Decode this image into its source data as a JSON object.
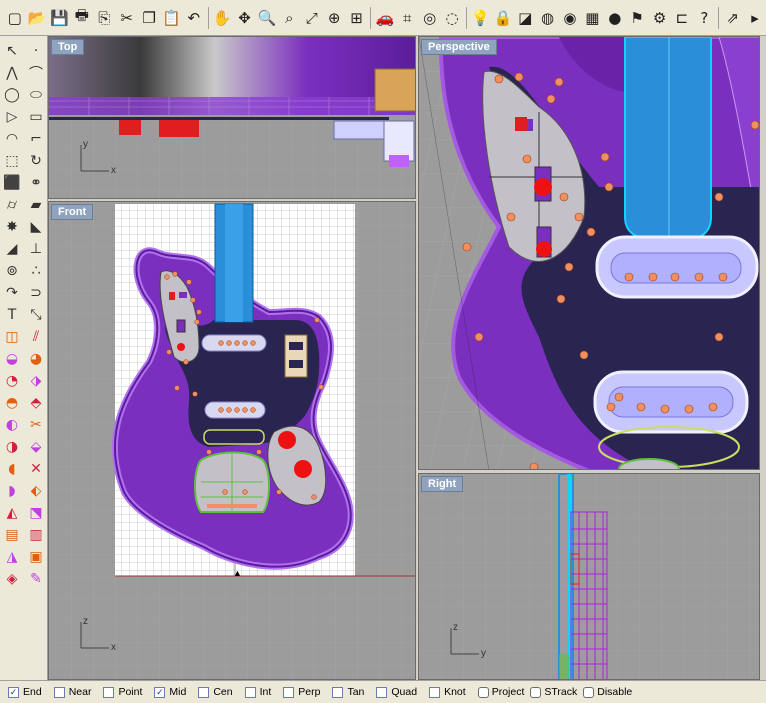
{
  "toolbar_top": {
    "icons": [
      {
        "name": "new-icon",
        "glyph": "▢"
      },
      {
        "name": "open-icon",
        "glyph": "📂"
      },
      {
        "name": "save-icon",
        "glyph": "💾"
      },
      {
        "name": "print-icon",
        "glyph": "🖶"
      },
      {
        "name": "import-icon",
        "glyph": "⎘"
      },
      {
        "name": "cut-icon",
        "glyph": "✂"
      },
      {
        "name": "copy-icon",
        "glyph": "❐"
      },
      {
        "name": "paste-icon",
        "glyph": "📋"
      },
      {
        "name": "undo-icon",
        "glyph": "↶"
      },
      {
        "name": "pan-hand-icon",
        "glyph": "✋"
      },
      {
        "name": "move-icon",
        "glyph": "✥"
      },
      {
        "name": "zoom-icon",
        "glyph": "🔍"
      },
      {
        "name": "zoom-window-icon",
        "glyph": "⌕"
      },
      {
        "name": "zoom-extents-icon",
        "glyph": "⤢"
      },
      {
        "name": "zoom-selected-icon",
        "glyph": "⊕"
      },
      {
        "name": "four-viewports-icon",
        "glyph": "⊞"
      },
      {
        "name": "car-icon",
        "glyph": "🚗"
      },
      {
        "name": "wireframe-icon",
        "glyph": "⌗"
      },
      {
        "name": "object-snap-icon",
        "glyph": "◎"
      },
      {
        "name": "render-sphere-icon",
        "glyph": "◌"
      },
      {
        "name": "light-icon",
        "glyph": "💡"
      },
      {
        "name": "lock-icon",
        "glyph": "🔒"
      },
      {
        "name": "layer-icon",
        "glyph": "◪"
      },
      {
        "name": "color-wheel-icon",
        "glyph": "◍"
      },
      {
        "name": "material-icon",
        "glyph": "◉"
      },
      {
        "name": "grid-icon",
        "glyph": "▦"
      },
      {
        "name": "globe-icon",
        "glyph": "●"
      },
      {
        "name": "flag-icon",
        "glyph": "⚑"
      },
      {
        "name": "settings-gear-icon",
        "glyph": "⚙"
      },
      {
        "name": "dimension-icon",
        "glyph": "⊏"
      },
      {
        "name": "help-icon",
        "glyph": "?"
      },
      {
        "name": "export-icon",
        "glyph": "⇗"
      },
      {
        "name": "more-icon",
        "glyph": "▸"
      }
    ]
  },
  "toolbar_left": {
    "icons": [
      {
        "name": "select-arrow-icon",
        "glyph": "↖"
      },
      {
        "name": "point-icon",
        "glyph": "·"
      },
      {
        "name": "polyline-icon",
        "glyph": "⋀"
      },
      {
        "name": "curve-icon",
        "glyph": "⌒"
      },
      {
        "name": "circle-icon",
        "glyph": "◯"
      },
      {
        "name": "ellipse-icon",
        "glyph": "⬭"
      },
      {
        "name": "polygon-icon",
        "glyph": "▷"
      },
      {
        "name": "rectangle-icon",
        "glyph": "▭"
      },
      {
        "name": "arc-icon",
        "glyph": "◠"
      },
      {
        "name": "fillet-icon",
        "glyph": "⌐"
      },
      {
        "name": "transform-icon",
        "glyph": "⬚"
      },
      {
        "name": "rotate-icon",
        "glyph": "↻"
      },
      {
        "name": "box-icon",
        "glyph": "⬛"
      },
      {
        "name": "spheres-icon",
        "glyph": "⚭"
      },
      {
        "name": "cylinder-icon",
        "glyph": "⌭"
      },
      {
        "name": "surface-icon",
        "glyph": "▰"
      },
      {
        "name": "explode-icon",
        "glyph": "✸"
      },
      {
        "name": "sweep-icon",
        "glyph": "◣"
      },
      {
        "name": "extrude-icon",
        "glyph": "◢"
      },
      {
        "name": "snap-bar-icon",
        "glyph": "⊥"
      },
      {
        "name": "boolean-icon",
        "glyph": "⊚"
      },
      {
        "name": "array-icon",
        "glyph": "∴"
      },
      {
        "name": "blend-icon",
        "glyph": "↷"
      },
      {
        "name": "offset-icon",
        "glyph": "⊃"
      },
      {
        "name": "text-icon",
        "glyph": "T"
      },
      {
        "name": "scale-icon",
        "glyph": "⤡"
      },
      {
        "name": "cage-icon",
        "glyph": "◫"
      },
      {
        "name": "mirror-icon",
        "glyph": "⫽"
      },
      {
        "name": "solid-cap-icon",
        "glyph": "◒"
      },
      {
        "name": "solid-pipe-icon",
        "glyph": "◕"
      },
      {
        "name": "edit-pts-icon",
        "glyph": "◔"
      },
      {
        "name": "loft-icon",
        "glyph": "⬗"
      },
      {
        "name": "rebuild-icon",
        "glyph": "◓"
      },
      {
        "name": "network-icon",
        "glyph": "⬘"
      },
      {
        "name": "patch-icon",
        "glyph": "◐"
      },
      {
        "name": "trim-icon",
        "glyph": "✂"
      },
      {
        "name": "split-icon",
        "glyph": "◑"
      },
      {
        "name": "join-icon",
        "glyph": "⬙"
      },
      {
        "name": "flow-icon",
        "glyph": "◖"
      },
      {
        "name": "twist-icon",
        "glyph": "✕"
      },
      {
        "name": "bend-icon",
        "glyph": "◗"
      },
      {
        "name": "dimension-tool-icon",
        "glyph": "⬖"
      },
      {
        "name": "analyze-icon",
        "glyph": "◭"
      },
      {
        "name": "render-box-icon",
        "glyph": "⬔"
      },
      {
        "name": "layout-icon",
        "glyph": "▤"
      },
      {
        "name": "mesh-icon",
        "glyph": "▥"
      },
      {
        "name": "unroll-icon",
        "glyph": "◮"
      },
      {
        "name": "extract-icon",
        "glyph": "▣"
      },
      {
        "name": "tag-icon",
        "glyph": "◈"
      },
      {
        "name": "pen-icon",
        "glyph": "✎"
      }
    ]
  },
  "viewports": {
    "top": {
      "label": "Top",
      "axis_y": "y",
      "axis_x": "x"
    },
    "perspective": {
      "label": "Perspective"
    },
    "front": {
      "label": "Front",
      "axis_y": "z",
      "axis_x": "x"
    },
    "right": {
      "label": "Right",
      "axis_y": "z",
      "axis_x": "y"
    }
  },
  "statusbar": {
    "snaps": [
      {
        "label": "End",
        "checked": true
      },
      {
        "label": "Near",
        "checked": false
      },
      {
        "label": "Point",
        "checked": false
      },
      {
        "label": "Mid",
        "checked": true
      },
      {
        "label": "Cen",
        "checked": false
      },
      {
        "label": "Int",
        "checked": false
      },
      {
        "label": "Perp",
        "checked": false
      },
      {
        "label": "Tan",
        "checked": false
      },
      {
        "label": "Quad",
        "checked": false
      },
      {
        "label": "Knot",
        "checked": false
      }
    ],
    "toggles": [
      {
        "label": "Project"
      },
      {
        "label": "STrack"
      },
      {
        "label": "Disable"
      }
    ]
  },
  "colors": {
    "body_purple": "#7b2fbf",
    "body_edge": "#a35ae0",
    "pickguard_dark": "#2a2550",
    "pickguard_light": "#c4c0c8",
    "neck_blue": "#2a8ed8",
    "pickup_white": "#e0e0f0",
    "knob_red": "#ee1111",
    "screw_orange": "#f09060",
    "viewport_gray": "#9c9c9c",
    "label_blue": "#8fa3bf",
    "grid_line": "#a8a8a8"
  }
}
